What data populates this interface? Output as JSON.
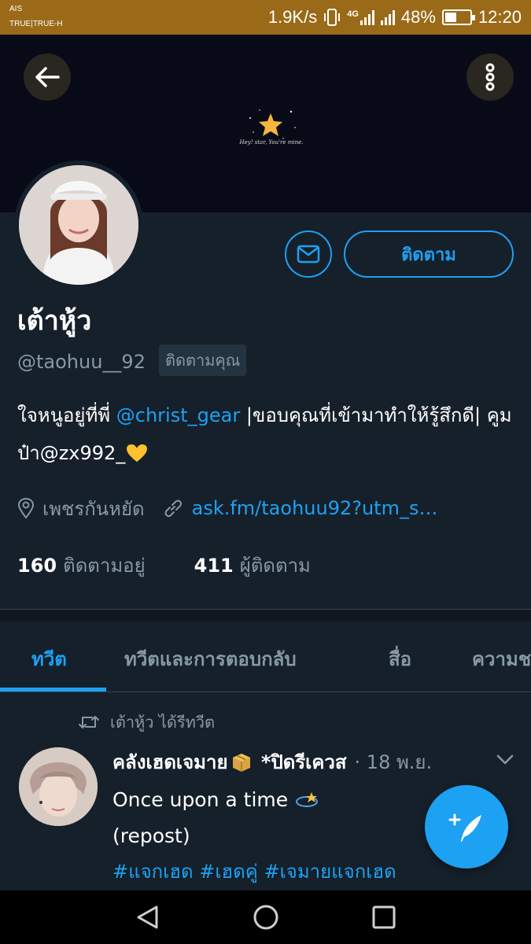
{
  "status_bar": {
    "carrier_1": "AIS",
    "carrier_2": "TRUE|TRUE-H",
    "speed": "1.9K/s",
    "network": "4G",
    "battery_percent": "48%",
    "battery_level": 0.48,
    "time": "12:20"
  },
  "banner": {
    "caption": "Hey! star, You're mine."
  },
  "actions": {
    "follow_label": "ติดตาม"
  },
  "profile": {
    "name": "เต้าหู้ว",
    "handle": "@taohuu__92",
    "follows_you": "ติดตามคุณ",
    "bio_prefix": "ใจหนูอยู่ที่พี่ ",
    "bio_mention": "@christ_gear",
    "bio_suffix": " |ขอบคุณที่เข้ามาทำให้รู้สึกดี| คูมป๋า@zx992_",
    "location": "เพชรกันหยัด",
    "website": "ask.fm/taohuu92?utm_s…",
    "following_count": "160",
    "following_label": "ติดตามอยู่",
    "followers_count": "411",
    "followers_label": "ผู้ติดตาม"
  },
  "tabs": [
    {
      "label": "ทวีต"
    },
    {
      "label": "ทวีตและการตอบกลับ"
    },
    {
      "label": "สื่อ"
    },
    {
      "label": "ความชอบ"
    }
  ],
  "tweet": {
    "retweet_label": "เต้าหู้ว ได้รีทวีต",
    "author_part1": "คลังเฮดเจมาย",
    "author_part2": " *ปิดรีเควส",
    "time": "· 18 พ.ย.",
    "line1": "Once upon a time ",
    "line2": "(repost)",
    "hashtags": "#แจกเฮด #เฮดคู่ #เจมายแจกเฮด"
  },
  "colors": {
    "accent": "#1da1f2",
    "background": "#15202b",
    "secondary_text": "#8899a6",
    "status_bar": "#9a6a18"
  },
  "icons": [
    "back-arrow-icon",
    "more-vertical-icon",
    "mail-icon",
    "location-pin-icon",
    "link-icon",
    "retweet-icon",
    "chevron-down-icon",
    "compose-tweet-icon",
    "nav-back-icon",
    "nav-home-icon",
    "nav-recents-icon"
  ]
}
